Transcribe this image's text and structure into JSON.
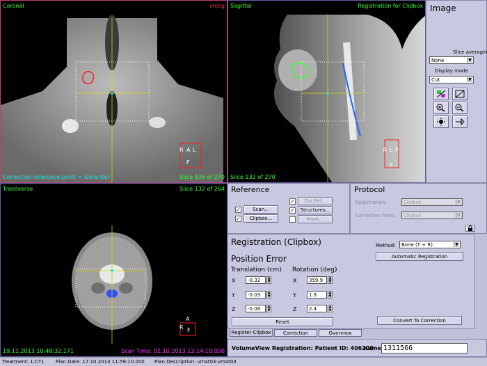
{
  "viewports": {
    "coronal": {
      "name": "Coronal",
      "corner": "ch/cg",
      "bottom_left": "Correction reference point = isocenter",
      "bottom_right": "Slice 136 of 270"
    },
    "sagittal": {
      "name": "Sagittal",
      "corner": "Registration for Clipbox",
      "bottom_left": "Slice 132 of 270"
    },
    "transverse": {
      "name": "Transverse",
      "corner": "Slice 132 of 264",
      "bottom_left": "19.11.2013 10:48:32.171",
      "bottom_right": "Scan Time: 02.10.2013 12:14:19.000"
    }
  },
  "orientation": {
    "coronal": [
      "R",
      "A",
      "L",
      "F"
    ],
    "sagittal": [
      "A",
      "L",
      "P",
      "F"
    ],
    "transverse": [
      "A",
      "R",
      "F"
    ]
  },
  "image_panel": {
    "title": "Image",
    "slice_averaging_label": "Slice averaging",
    "slice_averaging_value": "None",
    "display_mode_label": "Display mode",
    "display_mode_value": "Cut"
  },
  "reference": {
    "title": "Reference",
    "scan": "Scan...",
    "clipbox": "Clipbox...",
    "cor_ref": "Cor.Ref...",
    "structures": "Structures...",
    "mask": "Mask..."
  },
  "protocol": {
    "title": "Protocol",
    "registration_label": "Registration:",
    "registration_value": "Clipbox",
    "correction_from_label": "Correction from:",
    "correction_from_value": "Clipbox"
  },
  "registration": {
    "title": "Registration (Clipbox)",
    "method_label": "Method:",
    "method_value": "Bone (T + R)",
    "auto_button": "Automatic Registration",
    "position_error_title": "Position Error",
    "translation_label": "Translation (cm)",
    "rotation_label": "Rotation (deg)",
    "axes": [
      "X",
      "Y",
      "Z"
    ],
    "translation": [
      "-0.32",
      "-0.03",
      "-0.08"
    ],
    "rotation": [
      "359.9",
      "1.9",
      "2.4"
    ],
    "reset_button": "Reset",
    "convert_button": "Convert To Correction"
  },
  "tabs": [
    "Register Clipbox",
    "Correction",
    "Overview"
  ],
  "info": {
    "patient_label": "VolumeView Registration: Patient ID: 406208",
    "name_label": "Name:",
    "name_value": "1311566"
  },
  "statusbar": {
    "treatment": "Treatment: 1:CT1",
    "plan_date": "Plan Date: 17.10.2013 11:59:10.000",
    "plan_description": "Plan Description: vmat03:vmat03"
  }
}
